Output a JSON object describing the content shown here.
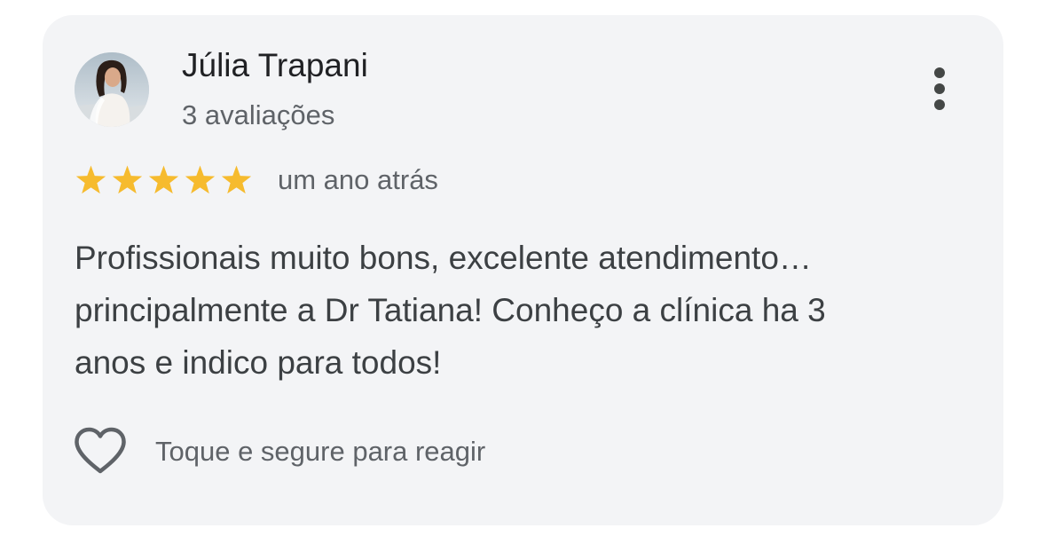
{
  "review": {
    "author_name": "Júlia Trapani",
    "author_reviews_count": "3 avaliações",
    "rating": 5,
    "rating_max": 5,
    "time_ago": "um ano atrás",
    "text_lines": [
      "Profissionais muito bons, excelente atendimento…",
      "principalmente a Dr Tatiana! Conheço a clínica ha 3",
      "anos e indico para todos!"
    ],
    "react_hint": "Toque e segure para reagir"
  },
  "icons": {
    "avatar": "profile-photo",
    "more": "more-vert-icon",
    "star": "star-icon",
    "heart": "heart-outline-icon"
  },
  "colors": {
    "card_background": "#f3f4f6",
    "star": "#f6bb2e",
    "primary_text": "#202124",
    "secondary_text": "#5f6368",
    "body_text": "#3c4043",
    "icon": "#444746"
  }
}
